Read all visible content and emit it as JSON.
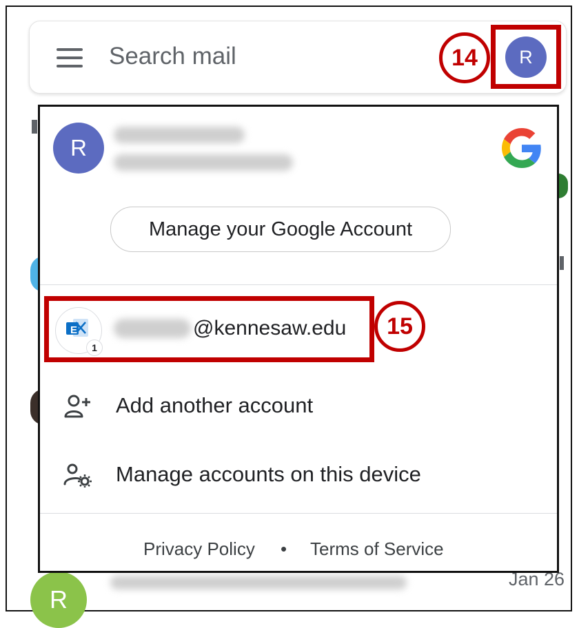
{
  "search": {
    "placeholder": "Search mail"
  },
  "avatar_initial": "R",
  "callouts": {
    "first": "14",
    "second": "15"
  },
  "account_menu": {
    "manage_label": "Manage your Google Account",
    "exchange_account_suffix": "@kennesaw.edu",
    "exchange_badge_count": "1",
    "exchange_icon_letter": "E",
    "add_account_label": "Add another account",
    "manage_device_label": "Manage accounts on this device",
    "privacy_label": "Privacy Policy",
    "separator": "•",
    "terms_label": "Terms of Service"
  },
  "background_list": {
    "last_item_date": "Jan 26",
    "last_item_avatar": "R"
  },
  "colors": {
    "accent_red": "#c00000",
    "avatar_indigo": "#5c6bc0",
    "avatar_green": "#8bc34a",
    "exchange_blue": "#0b6fc6"
  },
  "icons": [
    "menu-icon",
    "google-g-icon",
    "exchange-icon",
    "add-person-icon",
    "manage-accounts-icon"
  ]
}
